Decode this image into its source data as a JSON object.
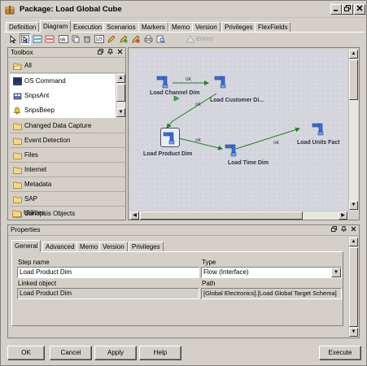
{
  "window": {
    "title": "Package: Load Global Cube"
  },
  "tabs": [
    {
      "label": "Definition"
    },
    {
      "label": "Diagram",
      "active": true
    },
    {
      "label": "Execution"
    },
    {
      "label": "Scenarios"
    },
    {
      "label": "Markers"
    },
    {
      "label": "Memo"
    },
    {
      "label": "Version"
    },
    {
      "label": "Privileges"
    },
    {
      "label": "FlexFields"
    }
  ],
  "toolbar": {
    "errors_label": "Errors"
  },
  "toolbox": {
    "title": "Toolbox",
    "all_label": "All",
    "tools": [
      {
        "label": "OS Command",
        "icon": "terminal-icon"
      },
      {
        "label": "SnpsAnt",
        "icon": "ant-icon"
      },
      {
        "label": "SnpsBeep",
        "icon": "bell-icon"
      }
    ],
    "folders": [
      {
        "label": "Changed Data Capture"
      },
      {
        "label": "Event Detection"
      },
      {
        "label": "Files"
      },
      {
        "label": "Internet"
      },
      {
        "label": "Metadata"
      },
      {
        "label": "SAP"
      },
      {
        "label": "Sunopsis Objects"
      },
      {
        "label": "Utilities"
      }
    ]
  },
  "diagram": {
    "nodes": [
      {
        "label": "Load Channel Dim"
      },
      {
        "label": "Load Customer Di..."
      },
      {
        "label": "Load Product Dim",
        "selected": true
      },
      {
        "label": "Load Time Dim"
      },
      {
        "label": "Load Units Fact"
      }
    ],
    "link_label": "ok"
  },
  "properties": {
    "title": "Properties",
    "tabs": [
      {
        "label": "General",
        "active": true
      },
      {
        "label": "Advanced"
      },
      {
        "label": "Memo"
      },
      {
        "label": "Version"
      },
      {
        "label": "Privileges"
      }
    ],
    "step_name_label": "Step name",
    "step_name_value": "Load Product Dim",
    "type_label": "Type",
    "type_value": "Flow (Interface)",
    "linked_object_label": "Linked object",
    "linked_object_value": "Load Product Dim",
    "path_label": "Path",
    "path_value": "[Global Electronics].[Load Global Target Schema]"
  },
  "buttons": {
    "ok": "OK",
    "cancel": "Cancel",
    "apply": "Apply",
    "help": "Help",
    "execute": "Execute"
  }
}
